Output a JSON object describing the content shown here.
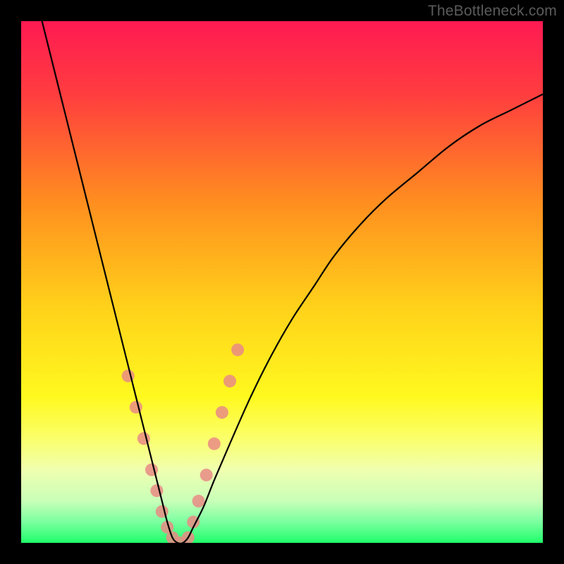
{
  "watermark": "TheBottleneck.com",
  "chart_data": {
    "type": "line",
    "title": "",
    "xlabel": "",
    "ylabel": "",
    "xlim": [
      0,
      100
    ],
    "ylim": [
      0,
      100
    ],
    "gradient_stops": [
      {
        "pct": 0,
        "color": "#ff1a52"
      },
      {
        "pct": 14,
        "color": "#ff3d3f"
      },
      {
        "pct": 35,
        "color": "#ff8f1f"
      },
      {
        "pct": 55,
        "color": "#ffd21a"
      },
      {
        "pct": 72,
        "color": "#fff91f"
      },
      {
        "pct": 80,
        "color": "#fbff6a"
      },
      {
        "pct": 86,
        "color": "#f0ffb0"
      },
      {
        "pct": 92,
        "color": "#c8ffb8"
      },
      {
        "pct": 96,
        "color": "#7affa0"
      },
      {
        "pct": 100,
        "color": "#1fff6a"
      }
    ],
    "series": [
      {
        "name": "bottleneck-curve",
        "color": "#000000",
        "x": [
          4,
          6,
          8,
          10,
          12,
          14,
          16,
          18,
          20,
          22,
          24,
          26,
          27,
          28,
          29,
          30,
          31,
          32,
          33,
          35,
          37,
          40,
          44,
          48,
          52,
          56,
          60,
          65,
          70,
          76,
          82,
          88,
          94,
          100
        ],
        "y": [
          100,
          92,
          84,
          76,
          68,
          60,
          52,
          44,
          36,
          28,
          20,
          12,
          8,
          4,
          1,
          0,
          0,
          1,
          3,
          7,
          12,
          19,
          28,
          36,
          43,
          49,
          55,
          61,
          66,
          71,
          76,
          80,
          83,
          86
        ]
      }
    ],
    "markers": {
      "name": "highlight-dots",
      "color": "#e98b85",
      "radius": 9,
      "x": [
        20.5,
        22,
        23.5,
        25,
        26,
        27,
        28,
        29,
        30.5,
        32,
        33,
        34,
        35.5,
        37,
        38.5,
        40,
        41.5
      ],
      "y": [
        32,
        26,
        20,
        14,
        10,
        6,
        3,
        1,
        0,
        1,
        4,
        8,
        13,
        19,
        25,
        31,
        37
      ]
    }
  }
}
